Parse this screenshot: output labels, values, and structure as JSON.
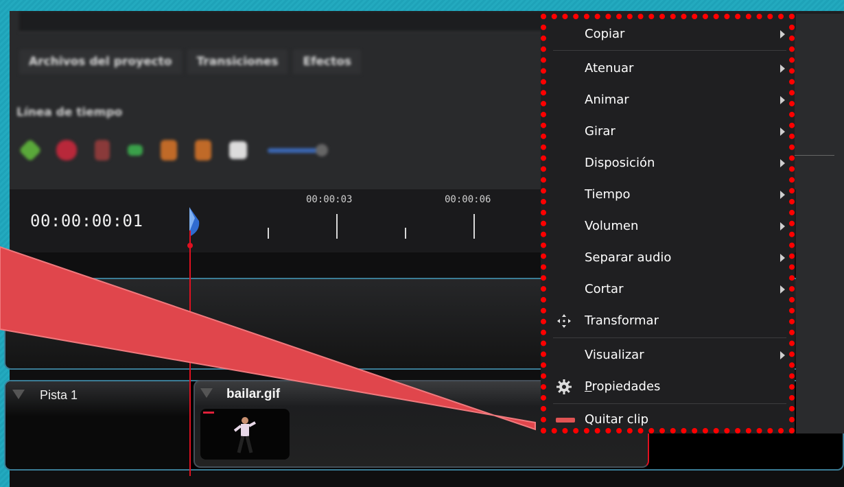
{
  "app": {
    "tabs": [
      "Archivos del proyecto",
      "Transiciones",
      "Efectos"
    ],
    "timeline_label": "Línea de tiempo"
  },
  "ruler": {
    "current_time": "00:00:00:01",
    "tick_labels": [
      "00:00:03",
      "00:00:06"
    ]
  },
  "tracks": [
    {
      "name": "Pista 1"
    }
  ],
  "clip": {
    "name": "bailar.gif"
  },
  "context_menu": {
    "items": [
      {
        "label": "Copiar",
        "submenu": true
      },
      {
        "label": "Atenuar",
        "submenu": true
      },
      {
        "label": "Animar",
        "submenu": true
      },
      {
        "label": "Girar",
        "submenu": true
      },
      {
        "label": "Disposición",
        "submenu": true
      },
      {
        "label": "Tiempo",
        "submenu": true
      },
      {
        "label": "Volumen",
        "submenu": true
      },
      {
        "label": "Separar audio",
        "submenu": true
      },
      {
        "label": "Cortar",
        "submenu": true
      },
      {
        "label": "Transformar",
        "submenu": false,
        "icon": "move-arrows-icon"
      },
      {
        "label": "Visualizar",
        "submenu": true
      },
      {
        "label": "Propiedades",
        "submenu": false,
        "icon": "gear-icon"
      },
      {
        "label": "Quitar clip",
        "submenu": false,
        "icon": "remove-clip-icon"
      }
    ]
  },
  "colors": {
    "frame": "#1fa0b6",
    "menu_border": "#ff0000",
    "playhead": "#e01020",
    "callout": "#e0464c"
  }
}
